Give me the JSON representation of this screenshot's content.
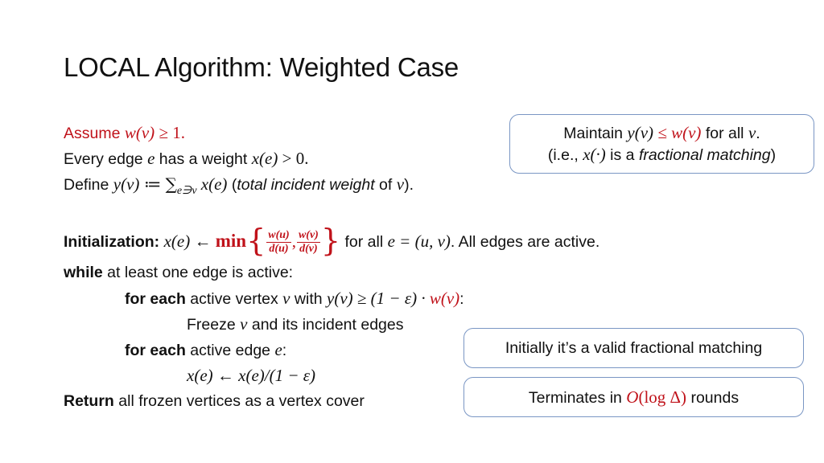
{
  "slide": {
    "title": "LOCAL Algorithm: Weighted Case",
    "assume": {
      "word": "Assume ",
      "expr": "w(v)",
      "rel": " ≥ 1."
    },
    "edge_line": {
      "t1": "Every edge ",
      "e": "e",
      "t2": " has a weight ",
      "expr": "x(e)",
      "rel": " > 0."
    },
    "define_line": {
      "t1": "Define ",
      "y": "y(v)",
      "op": " ≔ ",
      "sum": "∑",
      "sub": "e∋v",
      "x": " x(e)",
      "t2": " (",
      "italic": "total incident weight",
      "t3": " of ",
      "v": "v",
      "t4": ")."
    },
    "init": {
      "label": "Initialization:",
      "lhs": "x(e)",
      "arrow": " ← ",
      "min": "min",
      "lbrace": "{",
      "frac1_num": "w(u)",
      "frac1_den": "d(u)",
      "comma": ",",
      "frac2_num": "w(v)",
      "frac2_den": "d(v)",
      "rbrace": "}",
      "t1": " for all ",
      "eq": "e = (u, v)",
      "t2": ". All edges are active."
    },
    "while_line": {
      "kw": "while",
      "text": " at least one edge is active:"
    },
    "for_vertex": {
      "kw": "for each",
      "t1": " active vertex ",
      "v": "v",
      "t2": " with ",
      "expr": "y(v) ≥ (1 − ε) · ",
      "red": "w(v)",
      "t3": ":"
    },
    "freeze": {
      "t1": "Freeze ",
      "v": "v",
      "t2": " and its incident edges"
    },
    "for_edge": {
      "kw": "for each",
      "t1": " active edge ",
      "e": "e",
      "t2": ":"
    },
    "update": {
      "expr": "x(e) ← x(e)/(1 − ε)"
    },
    "return_line": {
      "kw": "Return",
      "text": " all frozen vertices as a vertex cover"
    }
  },
  "callouts": {
    "maintain": {
      "t1": "Maintain ",
      "y": "y(v)",
      "red": " ≤ w(v)",
      "t2": " for all ",
      "v": "v",
      "t3": ".",
      "l2_t1": "(i.e., ",
      "x": "x(·)",
      "l2_t2": " is a ",
      "italic": "fractional matching",
      "l2_t3": ")"
    },
    "initially": {
      "text": "Initially it’s a valid fractional matching"
    },
    "terminates": {
      "t1": "Terminates in ",
      "red": "O",
      "expr": "(log Δ)",
      "t2": " rounds"
    }
  },
  "colors": {
    "accent_red": "#c0121a",
    "box_border": "#7a96c4",
    "text": "#111111"
  }
}
